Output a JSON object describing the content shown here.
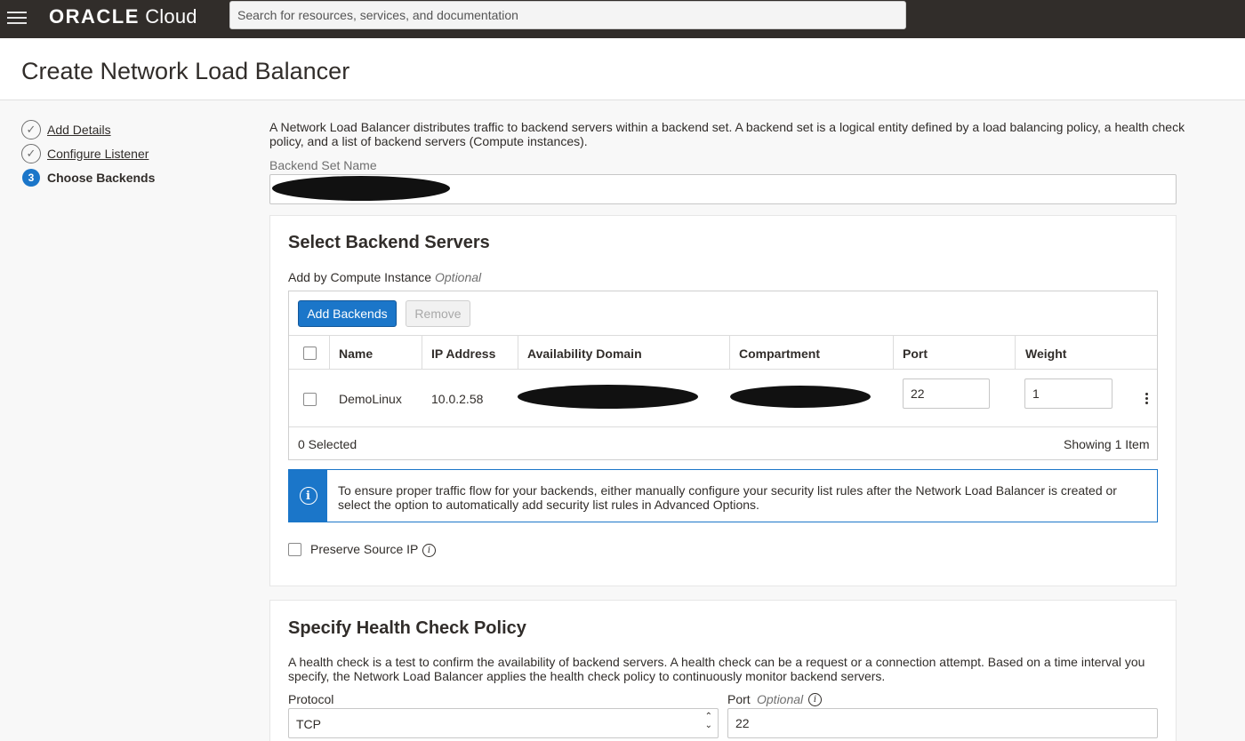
{
  "topbar": {
    "logo_brand": "ORACLE",
    "logo_product": "Cloud",
    "search_placeholder": "Search for resources, services, and documentation"
  },
  "page": {
    "title": "Create Network Load Balancer"
  },
  "steps": [
    {
      "label": "Add Details",
      "state": "done"
    },
    {
      "label": "Configure Listener",
      "state": "done"
    },
    {
      "label": "Choose Backends",
      "state": "current",
      "number": "3"
    }
  ],
  "intro": "A Network Load Balancer distributes traffic to backend servers within a backend set. A backend set is a logical entity defined by a load balancing policy, a health check policy, and a list of backend servers (Compute instances).",
  "backend_set": {
    "label": "Backend Set Name",
    "value": ""
  },
  "select_backends": {
    "title": "Select Backend Servers",
    "add_by_label": "Add by Compute Instance",
    "optional": "Optional",
    "add_button": "Add Backends",
    "remove_button": "Remove",
    "columns": [
      "Name",
      "IP Address",
      "Availability Domain",
      "Compartment",
      "Port",
      "Weight"
    ],
    "rows": [
      {
        "name": "DemoLinux",
        "ip": "10.0.2.58",
        "availability_domain": "",
        "compartment": "",
        "port": "22",
        "weight": "1"
      }
    ],
    "selected_count": "0 Selected",
    "showing": "Showing 1 Item",
    "info": "To ensure proper traffic flow for your backends, either manually configure your security list rules after the Network Load Balancer is created or select the option to automatically add security list rules in Advanced Options.",
    "preserve_source_ip": "Preserve Source IP"
  },
  "health_check": {
    "title": "Specify Health Check Policy",
    "description": "A health check is a test to confirm the availability of backend servers. A health check can be a request or a connection attempt. Based on a time interval you specify, the Network Load Balancer applies the health check policy to continuously monitor backend servers.",
    "protocol_label": "Protocol",
    "protocol_value": "TCP",
    "port_label": "Port",
    "port_optional": "Optional",
    "port_value": "22"
  },
  "colors": {
    "accent": "#1b76c9",
    "topbar": "#312d2a"
  }
}
